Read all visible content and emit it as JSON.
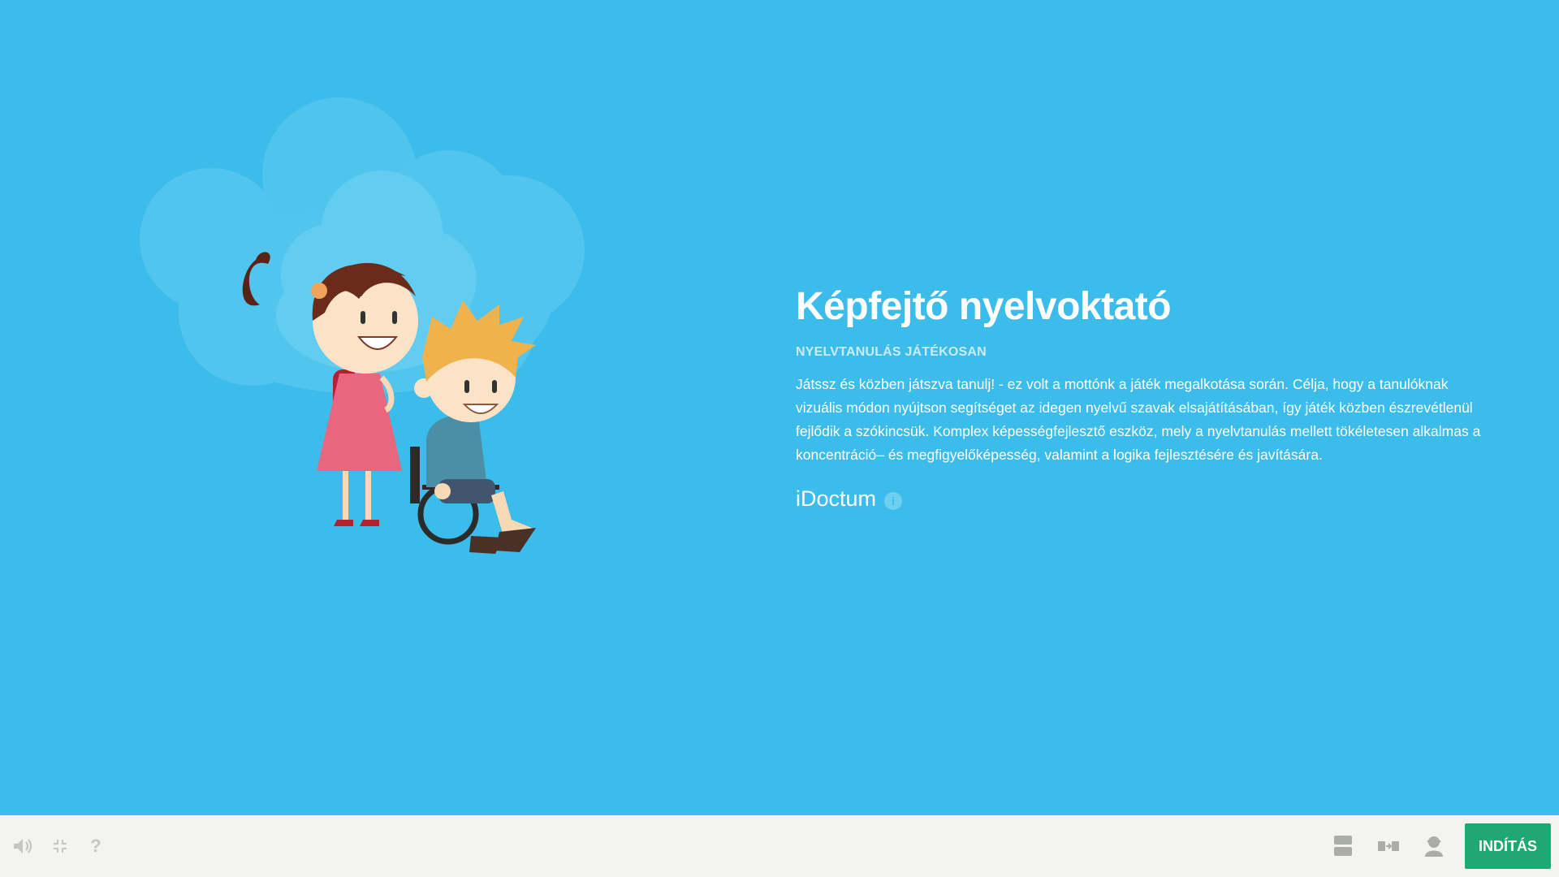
{
  "game": {
    "title": "Képfejtő nyelvoktató",
    "subtitle": "NYELVTANULÁS JÁTÉKOSAN",
    "description": "Játssz és közben játszva tanulj! - ez volt a mottónk a játék megalkotása során.  Célja, hogy a tanulóknak vizuális módon nyújtson segítséget az idegen nyelvű szavak elsajátításában, így játék közben észrevétlenül fejlődik a szókincsük.  Komplex képességfejlesztő eszköz, mely a nyelvtanulás mellett tökéletesen alkalmas a koncentráció– és megfigyelőképesség, valamint a logika fejlesztésére és javítására.",
    "brand": "iDoctum",
    "brand_info_glyph": "i"
  },
  "bottombar": {
    "left_icons": [
      "speaker-icon",
      "exit-fullscreen-icon",
      "help-icon"
    ],
    "help_glyph": "?",
    "right_icons": [
      "layout-rows-icon",
      "arrange-icon",
      "user-icon"
    ],
    "start_label": "INDÍTÁS"
  },
  "colors": {
    "background": "#3bbcea",
    "bottombar": "#f3f4f0",
    "start_button": "#20a872",
    "subtitle": "#c9ecf9"
  }
}
